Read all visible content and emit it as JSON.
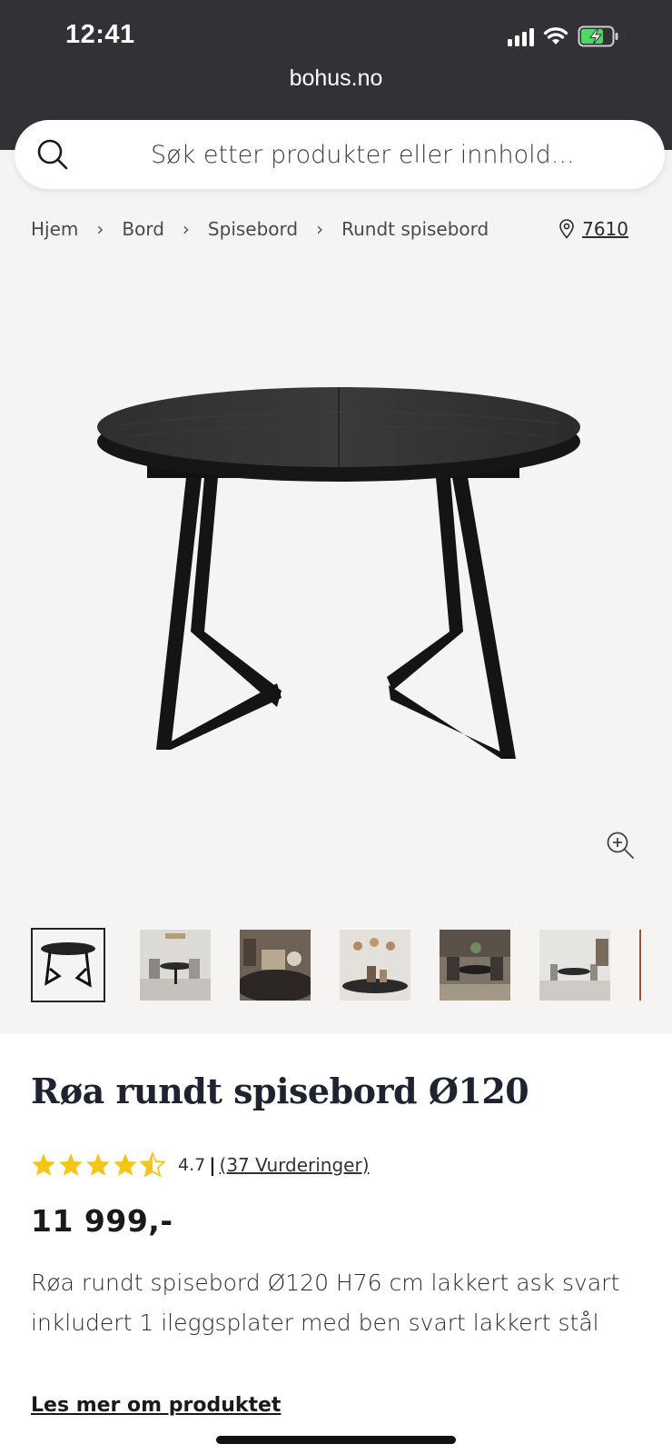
{
  "status_bar": {
    "time": "12:41",
    "icons": [
      "cellular-signal-icon",
      "wifi-icon",
      "battery-charging-icon"
    ]
  },
  "browser": {
    "url": "bohus.no"
  },
  "search": {
    "placeholder": "Søk etter produkter eller innhold..."
  },
  "breadcrumb": {
    "items": [
      "Hjem",
      "Bord",
      "Spisebord",
      "Rundt spisebord"
    ],
    "store_number": "7610"
  },
  "gallery": {
    "thumbnail_count_visible": 7,
    "selected_index": 0
  },
  "product": {
    "title": "Røa rundt spisebord Ø120",
    "rating_value": "4.7",
    "rating_separator": "|",
    "rating_count_label": "(37 Vurderinger)",
    "rating_stars": 4.5,
    "price": "11 999,-",
    "description": "Røa rundt spisebord Ø120 H76 cm lakkert ask svart inkludert 1 ileggsplater med ben svart lakkert stål",
    "read_more_label": "Les mer om produktet"
  },
  "colors": {
    "top_bar": "#323236",
    "page_bg": "#f5f4f2",
    "star": "#f5c518",
    "title": "#1d2330",
    "battery_green": "#4cd964"
  }
}
